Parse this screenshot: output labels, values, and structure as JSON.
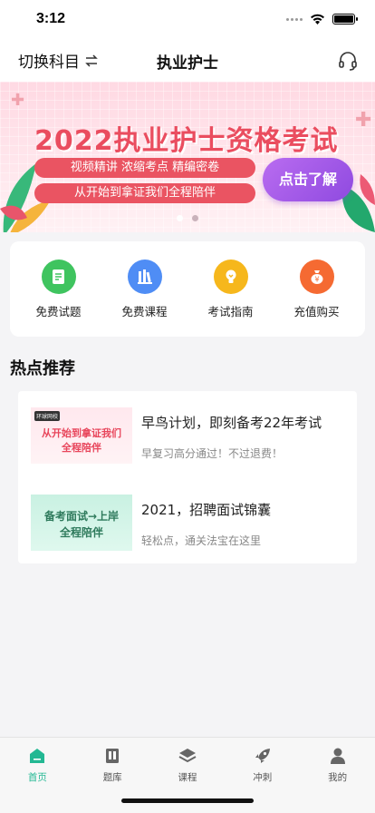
{
  "status_bar": {
    "time": "3:12"
  },
  "nav": {
    "switch_label": "切换科目",
    "switch_icon": "swap-arrows-icon",
    "title": "执业护士",
    "support_icon": "headset-icon"
  },
  "banner": {
    "title": "2022执业护士资格考试",
    "pill_1": "视频精讲 浓缩考点 精编密卷",
    "pill_2": "从开始到拿证我们全程陪伴",
    "cta": "点击了解",
    "active_dot": 0,
    "dot_count": 2
  },
  "quick_menu": [
    {
      "label": "免费试题",
      "icon": "exam-paper-icon",
      "color": "#3fc45f"
    },
    {
      "label": "免费课程",
      "icon": "books-icon",
      "color": "#4f8df5"
    },
    {
      "label": "考试指南",
      "icon": "lightbulb-icon",
      "color": "#f6b71c"
    },
    {
      "label": "充值购买",
      "icon": "money-bag-icon",
      "color": "#f56a32"
    }
  ],
  "section": {
    "title": "热点推荐"
  },
  "recommendations": [
    {
      "title": "早鸟计划，即刻备考22年考试",
      "subtitle": "早复习高分通过！不过退费！",
      "thumb_line_1": "从开始到拿证我们",
      "thumb_line_2": "全程陪伴",
      "thumb_logo": "环球网校"
    },
    {
      "title": "2021，招聘面试锦囊",
      "subtitle": "轻松点，通关法宝在这里",
      "thumb_line_1": "备考面试→上岸",
      "thumb_line_2": "全程陪伴"
    }
  ],
  "tab_bar": {
    "active": "首页",
    "tabs": [
      {
        "label": "首页",
        "icon": "home-icon"
      },
      {
        "label": "题库",
        "icon": "question-bank-icon"
      },
      {
        "label": "课程",
        "icon": "course-layers-icon"
      },
      {
        "label": "冲刺",
        "icon": "rocket-icon"
      },
      {
        "label": "我的",
        "icon": "user-icon"
      }
    ]
  },
  "colors": {
    "accent": "#23b893",
    "banner_red": "#ea4d5f",
    "cta_purple": "#9d55e6"
  }
}
